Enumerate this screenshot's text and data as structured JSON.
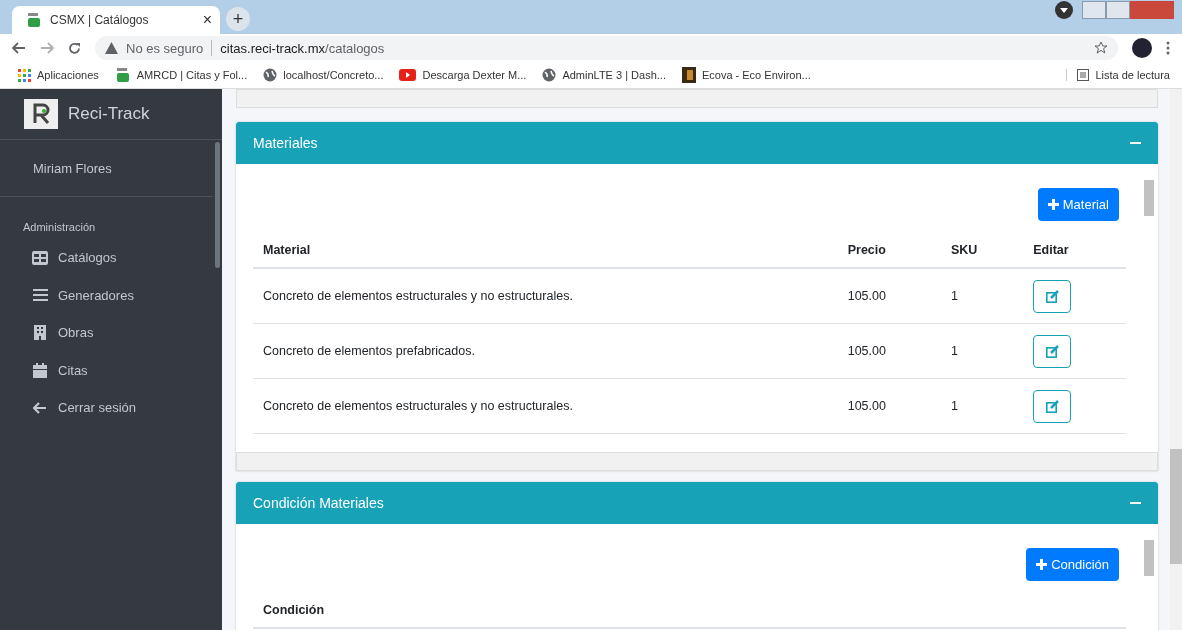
{
  "browser": {
    "tab_title": "CSMX | Catálogos",
    "tab_close": "×",
    "new_tab": "+",
    "security": "No es seguro",
    "url_host": "citas.reci-track.mx",
    "url_path": "/catalogos",
    "bookmarks": [
      {
        "label": "Aplicaciones",
        "kind": "apps"
      },
      {
        "label": "AMRCD | Citas y Fol...",
        "kind": "amr"
      },
      {
        "label": "localhost/Concreto...",
        "kind": "globe"
      },
      {
        "label": "Descarga Dexter M...",
        "kind": "video"
      },
      {
        "label": "AdminLTE 3 | Dash...",
        "kind": "globe"
      },
      {
        "label": "Ecova - Eco Environ...",
        "kind": "image"
      }
    ],
    "reading_list": "Lista de lectura"
  },
  "sidebar": {
    "brand": "Reci-Track",
    "user": "Miriam Flores",
    "section": "Administración",
    "items": [
      {
        "label": "Catálogos",
        "kind": "grid"
      },
      {
        "label": "Generadores",
        "kind": "bars"
      },
      {
        "label": "Obras",
        "kind": "building"
      },
      {
        "label": "Citas",
        "kind": "calendar"
      },
      {
        "label": "Cerrar sesión",
        "kind": "arrow"
      }
    ]
  },
  "cards": [
    {
      "title": "Materiales",
      "button": "Material",
      "columns": [
        "Material",
        "Precio",
        "SKU",
        "Editar"
      ],
      "rows": [
        [
          "Concreto de elementos estructurales y no estructurales.",
          "105.00",
          "1"
        ],
        [
          "Concreto de elementos prefabricados.",
          "105.00",
          "1"
        ],
        [
          "Concreto de elementos estructurales y no estructurales.",
          "105.00",
          "1"
        ]
      ]
    },
    {
      "title": "Condición Materiales",
      "button": "Condición",
      "columns": [
        "Condición"
      ]
    }
  ]
}
